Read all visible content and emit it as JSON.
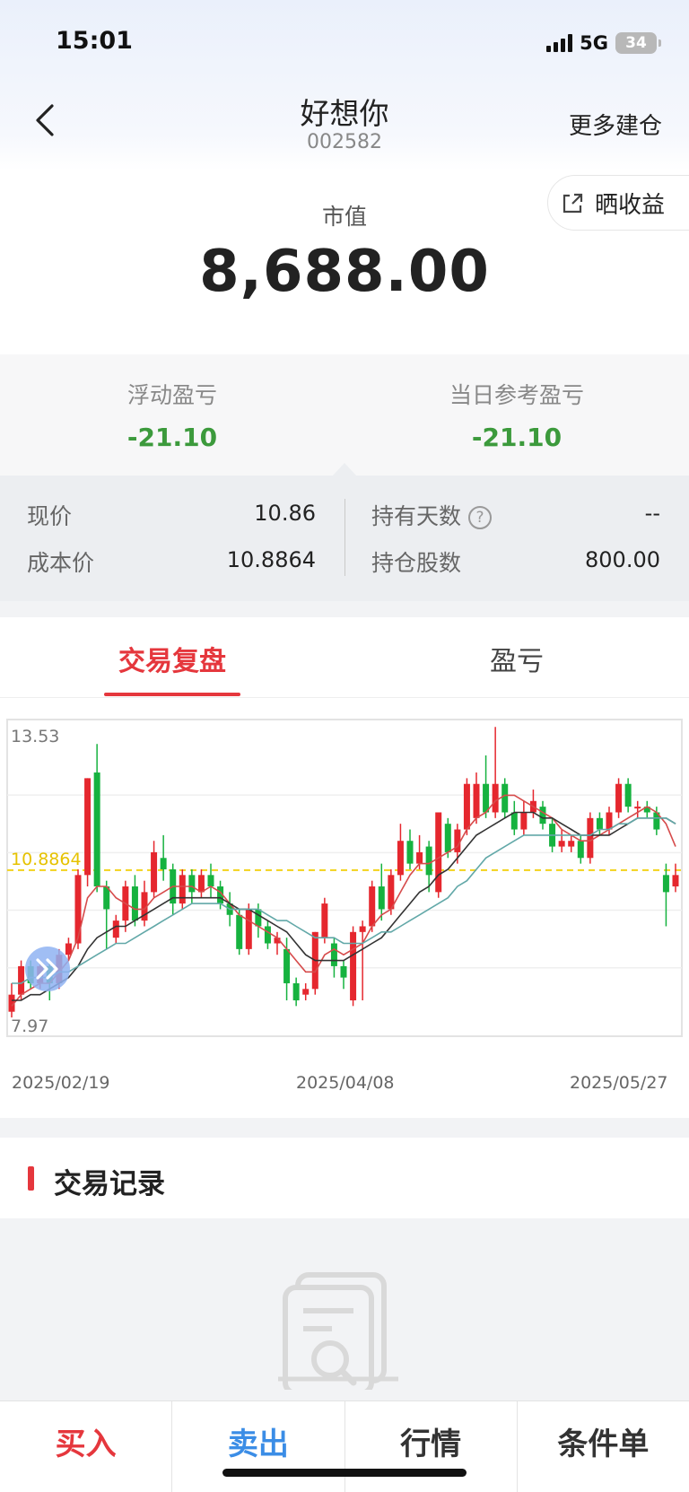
{
  "status_bar": {
    "time": "15:01",
    "network": "5G",
    "battery": "34"
  },
  "nav": {
    "title": "好想你",
    "code": "002582",
    "more": "更多建仓"
  },
  "share": {
    "label": "晒收益"
  },
  "market_value": {
    "label": "市值",
    "value": "8,688.00"
  },
  "pnl": {
    "floating_label": "浮动盈亏",
    "floating_value": "-21.10",
    "daily_label": "当日参考盈亏",
    "daily_value": "-21.10",
    "value_color": "#3c9a3c"
  },
  "info": {
    "price_label": "现价",
    "price_value": "10.86",
    "cost_label": "成本价",
    "cost_value": "10.8864",
    "days_label": "持有天数",
    "days_value": "--",
    "shares_label": "持仓股数",
    "shares_value": "800.00"
  },
  "tabs": [
    {
      "label": "交易复盘",
      "active": true
    },
    {
      "label": "盈亏",
      "active": false
    }
  ],
  "chart_data": {
    "type": "candlestick",
    "y_max_label": "13.53",
    "y_min_label": "7.97",
    "ylim": [
      7.97,
      13.53
    ],
    "cost_line": {
      "value": 10.8864,
      "label": "10.8864",
      "color": "#f2d21b"
    },
    "x_tick_labels": [
      "2025/02/19",
      "2025/04/08",
      "2025/05/27"
    ],
    "up_color": "#e5272e",
    "down_color": "#16b23f",
    "candles": [
      [
        8.4,
        8.7,
        8.9,
        8.3
      ],
      [
        8.7,
        9.2,
        9.3,
        8.6
      ],
      [
        9.2,
        8.9,
        9.3,
        8.8
      ],
      [
        8.9,
        9.2,
        9.3,
        8.8
      ],
      [
        9.2,
        8.9,
        9.3,
        8.6
      ],
      [
        8.9,
        9.4,
        9.5,
        8.8
      ],
      [
        9.4,
        9.6,
        9.7,
        9.3
      ],
      [
        9.6,
        10.8,
        10.9,
        9.5
      ],
      [
        10.8,
        12.5,
        12.5,
        10.6
      ],
      [
        12.6,
        10.6,
        13.1,
        10.5
      ],
      [
        10.6,
        10.2,
        10.7,
        9.5
      ],
      [
        9.7,
        10.0,
        10.1,
        9.6
      ],
      [
        10.0,
        10.6,
        10.7,
        9.8
      ],
      [
        10.6,
        10.0,
        10.8,
        9.9
      ],
      [
        10.0,
        10.5,
        10.7,
        9.9
      ],
      [
        10.5,
        11.2,
        11.4,
        10.4
      ],
      [
        11.1,
        10.9,
        11.5,
        10.7
      ],
      [
        10.9,
        10.3,
        11.0,
        10.1
      ],
      [
        10.3,
        10.8,
        10.9,
        10.2
      ],
      [
        10.8,
        10.5,
        10.9,
        10.3
      ],
      [
        10.5,
        10.8,
        10.9,
        10.4
      ],
      [
        10.8,
        10.6,
        11.0,
        10.4
      ],
      [
        10.6,
        10.3,
        10.7,
        10.2
      ],
      [
        10.3,
        10.1,
        10.5,
        9.9
      ],
      [
        10.1,
        9.5,
        10.2,
        9.4
      ],
      [
        9.5,
        10.2,
        10.3,
        9.4
      ],
      [
        10.2,
        9.9,
        10.3,
        9.7
      ],
      [
        9.9,
        9.6,
        10.0,
        9.5
      ],
      [
        9.6,
        9.7,
        9.8,
        9.4
      ],
      [
        9.5,
        8.9,
        9.7,
        8.6
      ],
      [
        8.9,
        8.6,
        9.0,
        8.5
      ],
      [
        8.7,
        8.8,
        8.9,
        8.6
      ],
      [
        8.8,
        9.8,
        9.8,
        8.7
      ],
      [
        9.7,
        10.3,
        10.4,
        9.6
      ],
      [
        9.6,
        9.2,
        9.7,
        9.0
      ],
      [
        9.2,
        9.0,
        9.3,
        8.8
      ],
      [
        8.6,
        9.8,
        9.9,
        8.5
      ],
      [
        9.8,
        9.9,
        10.0,
        8.6
      ],
      [
        9.9,
        10.6,
        10.7,
        9.8
      ],
      [
        10.6,
        10.2,
        11.0,
        10.0
      ],
      [
        10.2,
        10.8,
        10.9,
        10.1
      ],
      [
        10.8,
        11.4,
        11.7,
        10.7
      ],
      [
        11.4,
        11.0,
        11.6,
        10.9
      ],
      [
        11.0,
        11.2,
        11.5,
        10.9
      ],
      [
        11.3,
        10.8,
        11.4,
        10.5
      ],
      [
        10.5,
        11.9,
        11.9,
        10.4
      ],
      [
        11.7,
        11.2,
        11.8,
        11.1
      ],
      [
        11.2,
        11.6,
        11.7,
        11.0
      ],
      [
        11.6,
        12.4,
        12.5,
        11.5
      ],
      [
        11.8,
        12.4,
        12.6,
        11.7
      ],
      [
        12.4,
        11.9,
        12.9,
        11.8
      ],
      [
        11.9,
        12.4,
        13.4,
        11.8
      ],
      [
        12.4,
        11.9,
        12.5,
        11.8
      ],
      [
        11.9,
        11.6,
        12.1,
        11.5
      ],
      [
        11.6,
        11.9,
        12.1,
        11.5
      ],
      [
        11.9,
        12.1,
        12.3,
        11.8
      ],
      [
        12.0,
        11.7,
        12.1,
        11.6
      ],
      [
        11.7,
        11.3,
        11.8,
        11.2
      ],
      [
        11.3,
        11.4,
        11.6,
        11.2
      ],
      [
        11.3,
        11.4,
        11.5,
        11.2
      ],
      [
        11.4,
        11.1,
        11.5,
        11.0
      ],
      [
        11.1,
        11.8,
        11.9,
        11.0
      ],
      [
        11.8,
        11.6,
        11.9,
        11.5
      ],
      [
        11.6,
        11.9,
        12.0,
        11.5
      ],
      [
        11.9,
        12.4,
        12.5,
        11.8
      ],
      [
        12.4,
        12.0,
        12.5,
        11.9
      ],
      [
        12.0,
        12.0,
        12.1,
        11.8
      ],
      [
        12.0,
        11.9,
        12.1,
        11.8
      ],
      [
        11.9,
        11.6,
        12.0,
        11.5
      ],
      [
        10.8,
        10.5,
        11.0,
        9.9
      ],
      [
        10.6,
        10.8,
        11.0,
        10.5
      ]
    ],
    "ma_short": [
      8.5,
      8.7,
      8.8,
      8.9,
      8.9,
      9.1,
      9.3,
      9.7,
      10.4,
      10.6,
      10.6,
      10.4,
      10.3,
      10.2,
      10.2,
      10.4,
      10.5,
      10.6,
      10.6,
      10.6,
      10.5,
      10.6,
      10.5,
      10.3,
      10.1,
      10.0,
      9.9,
      9.8,
      9.7,
      9.5,
      9.3,
      9.1,
      9.1,
      9.4,
      9.5,
      9.4,
      9.5,
      9.6,
      9.9,
      10.1,
      10.2,
      10.5,
      10.8,
      11.0,
      11.0,
      11.1,
      11.2,
      11.3,
      11.6,
      11.8,
      11.9,
      12.1,
      12.2,
      12.2,
      12.1,
      12.0,
      11.9,
      11.8,
      11.6,
      11.5,
      11.4,
      11.4,
      11.5,
      11.6,
      11.7,
      11.8,
      11.9,
      12.0,
      11.9,
      11.7,
      11.3
    ],
    "ma_mid": [
      8.6,
      8.6,
      8.7,
      8.7,
      8.8,
      8.9,
      9.0,
      9.2,
      9.5,
      9.7,
      9.8,
      9.9,
      9.9,
      10.0,
      10.1,
      10.2,
      10.3,
      10.4,
      10.4,
      10.4,
      10.4,
      10.4,
      10.4,
      10.3,
      10.2,
      10.2,
      10.1,
      10.0,
      9.9,
      9.8,
      9.6,
      9.4,
      9.3,
      9.3,
      9.3,
      9.3,
      9.4,
      9.5,
      9.6,
      9.7,
      9.9,
      10.1,
      10.3,
      10.5,
      10.6,
      10.8,
      10.9,
      11.1,
      11.3,
      11.5,
      11.6,
      11.7,
      11.8,
      11.9,
      11.9,
      11.9,
      11.8,
      11.8,
      11.7,
      11.6,
      11.5,
      11.5,
      11.5,
      11.5,
      11.6,
      11.7,
      11.8,
      11.8,
      11.8,
      11.8,
      11.7
    ],
    "ma_long": [
      8.9,
      8.9,
      9.0,
      9.0,
      9.0,
      9.1,
      9.1,
      9.2,
      9.3,
      9.4,
      9.5,
      9.6,
      9.6,
      9.7,
      9.8,
      9.9,
      10.0,
      10.1,
      10.2,
      10.3,
      10.3,
      10.3,
      10.3,
      10.2,
      10.2,
      10.2,
      10.2,
      10.1,
      10.0,
      10.0,
      9.9,
      9.8,
      9.7,
      9.7,
      9.7,
      9.6,
      9.6,
      9.6,
      9.7,
      9.8,
      9.8,
      9.9,
      10.0,
      10.1,
      10.2,
      10.3,
      10.4,
      10.6,
      10.7,
      10.9,
      11.1,
      11.2,
      11.3,
      11.4,
      11.5,
      11.5,
      11.5,
      11.5,
      11.5,
      11.5,
      11.5,
      11.5,
      11.6,
      11.6,
      11.7,
      11.7,
      11.8,
      11.8,
      11.8,
      11.8,
      11.7
    ],
    "ma_colors": [
      "#d64b4b",
      "#333333",
      "#62a8a8"
    ],
    "grid": true
  },
  "records": {
    "title": "交易记录"
  },
  "bottom_bar": {
    "buy": "买入",
    "sell": "卖出",
    "quote": "行情",
    "condition": "条件单",
    "buy_color": "#e5373d",
    "sell_color": "#3b8de6",
    "quote_color": "#333333",
    "condition_color": "#333333"
  }
}
